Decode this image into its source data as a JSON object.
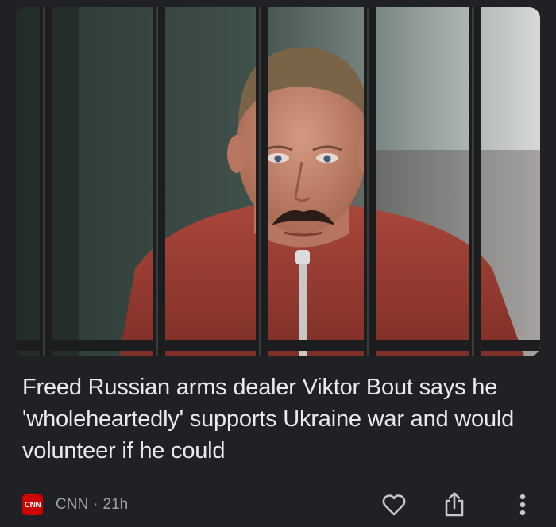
{
  "article": {
    "headline": "Freed Russian arms dealer Viktor Bout says he 'wholeheartedly' supports Ukraine war and would volunteer if he could",
    "source_logo_text": "CNN",
    "source_name": "CNN",
    "separator": "·",
    "age": "21h",
    "image_alt": "Man in red shirt behind prison bars"
  },
  "actions": {
    "like_icon": "heart-outline-icon",
    "share_icon": "share-icon",
    "more_icon": "more-vertical-icon"
  },
  "colors": {
    "background": "#202124",
    "headline_text": "#e8eaed",
    "meta_text": "#9aa0a6",
    "source_logo_bg": "#cc0000"
  }
}
